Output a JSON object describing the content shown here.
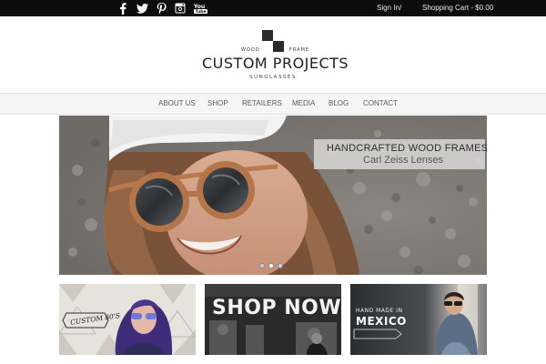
{
  "topbar": {
    "social_icons": [
      "facebook-icon",
      "twitter-icon",
      "pinterest-icon",
      "instagram-icon",
      "youtube-icon"
    ],
    "sign_in": "Sign In",
    "separator": "/",
    "cart": "Shopping Cart - $0.00"
  },
  "logo": {
    "word_left": "WOOD",
    "word_right": "FRAME",
    "title": "CUSTOM PROJECTS",
    "subtitle": "SUNGLASSES"
  },
  "nav": {
    "items": [
      "ABOUT US",
      "SHOP",
      "RETAILERS",
      "MEDIA",
      "BLOG",
      "CONTACT"
    ]
  },
  "hero": {
    "title": "HANDCRAFTED WOOD FRAMES",
    "subtitle": "Carl Zeiss Lenses",
    "slides": 3,
    "active_slide": 2
  },
  "tiles": [
    {
      "text": "CUSTOM 80'S"
    },
    {
      "text": "SHOP NOW"
    },
    {
      "line1": "HAND MADE IN",
      "line2": "MEXICO"
    }
  ],
  "colors": {
    "topbar": "#0d0d0d",
    "nav_bg": "#f5f5f5",
    "caption_bg": "#dcdcdc"
  }
}
